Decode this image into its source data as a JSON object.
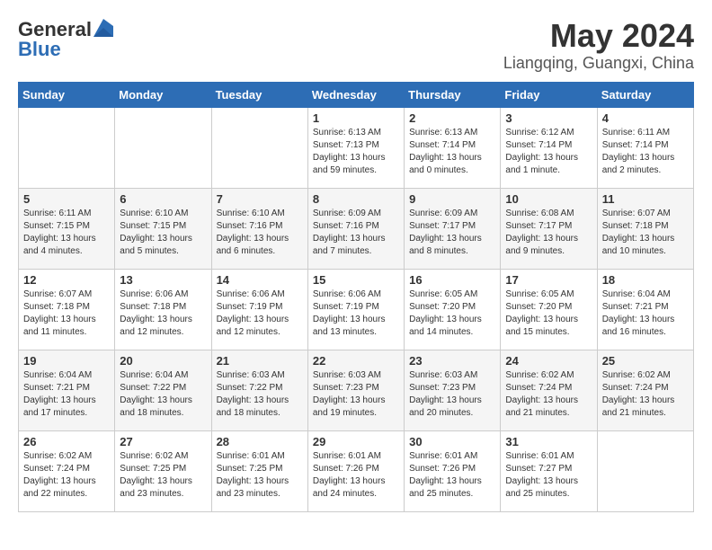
{
  "logo": {
    "general": "General",
    "blue": "Blue"
  },
  "title": {
    "month": "May 2024",
    "location": "Liangqing, Guangxi, China"
  },
  "days_of_week": [
    "Sunday",
    "Monday",
    "Tuesday",
    "Wednesday",
    "Thursday",
    "Friday",
    "Saturday"
  ],
  "weeks": [
    [
      {
        "day": "",
        "info": ""
      },
      {
        "day": "",
        "info": ""
      },
      {
        "day": "",
        "info": ""
      },
      {
        "day": "1",
        "info": "Sunrise: 6:13 AM\nSunset: 7:13 PM\nDaylight: 13 hours and 59 minutes."
      },
      {
        "day": "2",
        "info": "Sunrise: 6:13 AM\nSunset: 7:14 PM\nDaylight: 13 hours and 0 minutes."
      },
      {
        "day": "3",
        "info": "Sunrise: 6:12 AM\nSunset: 7:14 PM\nDaylight: 13 hours and 1 minute."
      },
      {
        "day": "4",
        "info": "Sunrise: 6:11 AM\nSunset: 7:14 PM\nDaylight: 13 hours and 2 minutes."
      }
    ],
    [
      {
        "day": "5",
        "info": "Sunrise: 6:11 AM\nSunset: 7:15 PM\nDaylight: 13 hours and 4 minutes."
      },
      {
        "day": "6",
        "info": "Sunrise: 6:10 AM\nSunset: 7:15 PM\nDaylight: 13 hours and 5 minutes."
      },
      {
        "day": "7",
        "info": "Sunrise: 6:10 AM\nSunset: 7:16 PM\nDaylight: 13 hours and 6 minutes."
      },
      {
        "day": "8",
        "info": "Sunrise: 6:09 AM\nSunset: 7:16 PM\nDaylight: 13 hours and 7 minutes."
      },
      {
        "day": "9",
        "info": "Sunrise: 6:09 AM\nSunset: 7:17 PM\nDaylight: 13 hours and 8 minutes."
      },
      {
        "day": "10",
        "info": "Sunrise: 6:08 AM\nSunset: 7:17 PM\nDaylight: 13 hours and 9 minutes."
      },
      {
        "day": "11",
        "info": "Sunrise: 6:07 AM\nSunset: 7:18 PM\nDaylight: 13 hours and 10 minutes."
      }
    ],
    [
      {
        "day": "12",
        "info": "Sunrise: 6:07 AM\nSunset: 7:18 PM\nDaylight: 13 hours and 11 minutes."
      },
      {
        "day": "13",
        "info": "Sunrise: 6:06 AM\nSunset: 7:18 PM\nDaylight: 13 hours and 12 minutes."
      },
      {
        "day": "14",
        "info": "Sunrise: 6:06 AM\nSunset: 7:19 PM\nDaylight: 13 hours and 12 minutes."
      },
      {
        "day": "15",
        "info": "Sunrise: 6:06 AM\nSunset: 7:19 PM\nDaylight: 13 hours and 13 minutes."
      },
      {
        "day": "16",
        "info": "Sunrise: 6:05 AM\nSunset: 7:20 PM\nDaylight: 13 hours and 14 minutes."
      },
      {
        "day": "17",
        "info": "Sunrise: 6:05 AM\nSunset: 7:20 PM\nDaylight: 13 hours and 15 minutes."
      },
      {
        "day": "18",
        "info": "Sunrise: 6:04 AM\nSunset: 7:21 PM\nDaylight: 13 hours and 16 minutes."
      }
    ],
    [
      {
        "day": "19",
        "info": "Sunrise: 6:04 AM\nSunset: 7:21 PM\nDaylight: 13 hours and 17 minutes."
      },
      {
        "day": "20",
        "info": "Sunrise: 6:04 AM\nSunset: 7:22 PM\nDaylight: 13 hours and 18 minutes."
      },
      {
        "day": "21",
        "info": "Sunrise: 6:03 AM\nSunset: 7:22 PM\nDaylight: 13 hours and 18 minutes."
      },
      {
        "day": "22",
        "info": "Sunrise: 6:03 AM\nSunset: 7:23 PM\nDaylight: 13 hours and 19 minutes."
      },
      {
        "day": "23",
        "info": "Sunrise: 6:03 AM\nSunset: 7:23 PM\nDaylight: 13 hours and 20 minutes."
      },
      {
        "day": "24",
        "info": "Sunrise: 6:02 AM\nSunset: 7:24 PM\nDaylight: 13 hours and 21 minutes."
      },
      {
        "day": "25",
        "info": "Sunrise: 6:02 AM\nSunset: 7:24 PM\nDaylight: 13 hours and 21 minutes."
      }
    ],
    [
      {
        "day": "26",
        "info": "Sunrise: 6:02 AM\nSunset: 7:24 PM\nDaylight: 13 hours and 22 minutes."
      },
      {
        "day": "27",
        "info": "Sunrise: 6:02 AM\nSunset: 7:25 PM\nDaylight: 13 hours and 23 minutes."
      },
      {
        "day": "28",
        "info": "Sunrise: 6:01 AM\nSunset: 7:25 PM\nDaylight: 13 hours and 23 minutes."
      },
      {
        "day": "29",
        "info": "Sunrise: 6:01 AM\nSunset: 7:26 PM\nDaylight: 13 hours and 24 minutes."
      },
      {
        "day": "30",
        "info": "Sunrise: 6:01 AM\nSunset: 7:26 PM\nDaylight: 13 hours and 25 minutes."
      },
      {
        "day": "31",
        "info": "Sunrise: 6:01 AM\nSunset: 7:27 PM\nDaylight: 13 hours and 25 minutes."
      },
      {
        "day": "",
        "info": ""
      }
    ]
  ]
}
